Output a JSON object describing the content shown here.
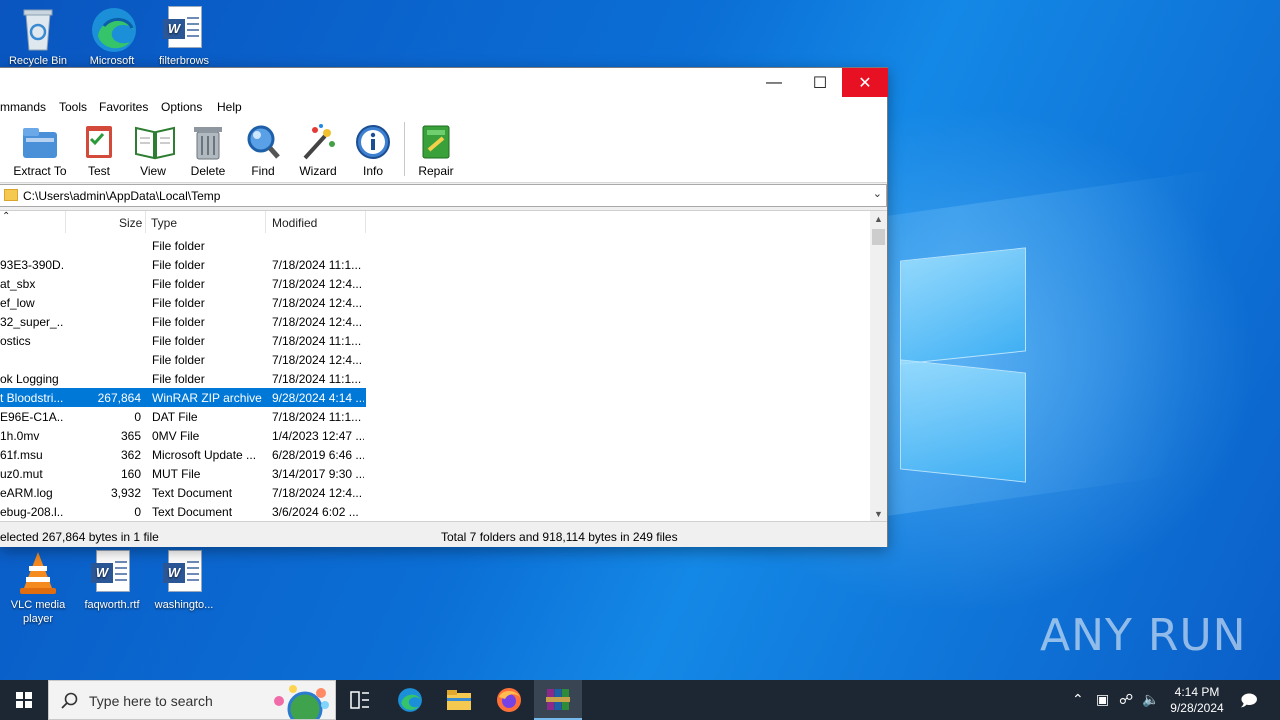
{
  "desktop": {
    "icons_top": [
      {
        "label": "Recycle Bin",
        "icon": "recycle-bin-icon"
      },
      {
        "label": "Microsoft",
        "icon": "edge-icon"
      },
      {
        "label": "filterbrows",
        "icon": "word-doc-icon"
      }
    ],
    "icons_bottom": [
      {
        "label": "VLC media player",
        "icon": "vlc-icon"
      },
      {
        "label": "faqworth.rtf",
        "icon": "word-doc-icon"
      },
      {
        "label": "washingto...",
        "icon": "word-doc-icon"
      }
    ],
    "watermark": "ANY RUN"
  },
  "window": {
    "controls": {
      "minimize": "—",
      "maximize": "☐",
      "close": "✕"
    },
    "menu": [
      "mmands",
      "Tools",
      "Favorites",
      "Options",
      "Help"
    ],
    "toolbar": [
      {
        "label": "Extract To",
        "icon": "extract-to-icon"
      },
      {
        "label": "Test",
        "icon": "test-icon"
      },
      {
        "label": "View",
        "icon": "view-book-icon"
      },
      {
        "label": "Delete",
        "icon": "trash-icon"
      },
      {
        "label": "Find",
        "icon": "magnifier-icon"
      },
      {
        "label": "Wizard",
        "icon": "wizard-wand-icon"
      },
      {
        "label": "Info",
        "icon": "info-icon"
      },
      {
        "label": "Repair",
        "icon": "repair-icon"
      }
    ],
    "address": "C:\\Users\\admin\\AppData\\Local\\Temp",
    "columns": {
      "size": "Size",
      "type": "Type",
      "modified": "Modified"
    },
    "rows": [
      {
        "name": "",
        "size": "",
        "type": "File folder",
        "modified": ""
      },
      {
        "name": "93E3-390D...",
        "size": "",
        "type": "File folder",
        "modified": "7/18/2024 11:1..."
      },
      {
        "name": "at_sbx",
        "size": "",
        "type": "File folder",
        "modified": "7/18/2024 12:4..."
      },
      {
        "name": "ef_low",
        "size": "",
        "type": "File folder",
        "modified": "7/18/2024 12:4..."
      },
      {
        "name": "32_super_...",
        "size": "",
        "type": "File folder",
        "modified": "7/18/2024 12:4..."
      },
      {
        "name": "ostics",
        "size": "",
        "type": "File folder",
        "modified": "7/18/2024 11:1..."
      },
      {
        "name": "",
        "size": "",
        "type": "File folder",
        "modified": "7/18/2024 12:4..."
      },
      {
        "name": "ok Logging",
        "size": "",
        "type": "File folder",
        "modified": "7/18/2024 11:1..."
      },
      {
        "name": "t Bloodstri...",
        "size": "267,864",
        "type": "WinRAR ZIP archive",
        "modified": "9/28/2024 4:14 ...",
        "selected": true
      },
      {
        "name": "E96E-C1A...",
        "size": "0",
        "type": "DAT File",
        "modified": "7/18/2024 11:1..."
      },
      {
        "name": "1h.0mv",
        "size": "365",
        "type": "0MV File",
        "modified": "1/4/2023 12:47 ..."
      },
      {
        "name": "61f.msu",
        "size": "362",
        "type": "Microsoft Update ...",
        "modified": "6/28/2019 6:46 ..."
      },
      {
        "name": "uz0.mut",
        "size": "160",
        "type": "MUT File",
        "modified": "3/14/2017 9:30 ..."
      },
      {
        "name": "eARM.log",
        "size": "3,932",
        "type": "Text Document",
        "modified": "7/18/2024 12:4..."
      },
      {
        "name": "ebug-208.l...",
        "size": "0",
        "type": "Text Document",
        "modified": "3/6/2024 6:02 ..."
      }
    ],
    "status_left": "elected 267,864 bytes in 1 file",
    "status_right": "Total 7 folders and 918,114 bytes in 249 files"
  },
  "taskbar": {
    "search_placeholder": "Type here to search",
    "time": "4:14 PM",
    "date": "9/28/2024",
    "apps": [
      "task-view-icon",
      "edge-icon",
      "file-explorer-icon",
      "firefox-icon",
      "winrar-icon"
    ]
  }
}
